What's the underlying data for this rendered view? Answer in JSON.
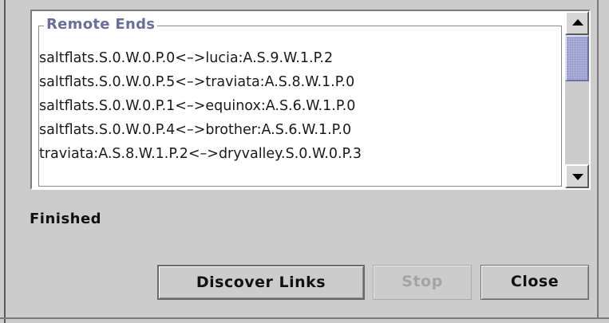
{
  "remote_ends": {
    "title": "Remote Ends",
    "items": [
      "saltflats.S.0.W.0.P.0<–>lucia:A.S.9.W.1.P.2",
      "saltflats.S.0.W.0.P.5<–>traviata:A.S.8.W.1.P.0",
      "saltflats.S.0.W.0.P.1<–>equinox:A.S.6.W.1.P.0",
      "saltflats.S.0.W.0.P.4<–>brother:A.S.6.W.1.P.0",
      "traviata:A.S.8.W.1.P.2<–>dryvalley.S.0.W.0.P.3"
    ]
  },
  "status": "Finished",
  "buttons": {
    "discover": "Discover Links",
    "stop": "Stop",
    "close": "Close"
  },
  "colors": {
    "background": "#cccccc",
    "border_title": "#6b6d9e",
    "scroll_thumb": "#b4b9e0",
    "disabled_text": "#a4a4a4"
  },
  "icons": {
    "scroll_up": "triangle-up",
    "scroll_down": "triangle-down"
  }
}
